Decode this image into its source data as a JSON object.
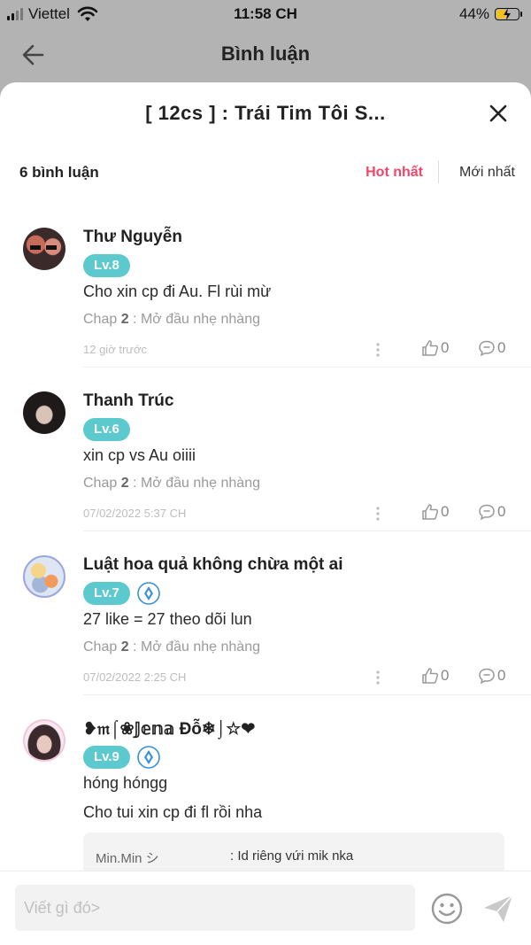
{
  "status": {
    "carrier": "Viettel",
    "time": "11:58 CH",
    "battery": "44%"
  },
  "nav": {
    "title": "Bình luận"
  },
  "sheet": {
    "title": "[ 12cs ] : Trái Tim Tôi S...",
    "count": "6 bình luận",
    "sort_hot": "Hot nhất",
    "sort_new": "Mới nhất"
  },
  "comments": [
    {
      "name": "Thư Nguyễn",
      "level": "Lv.8",
      "text": "Cho xin cp đi Au. Fl rùi mừ",
      "chap_prefix": "Chap ",
      "chap_no": "2",
      "chap_title": " : Mở đầu nhẹ nhàng",
      "time": "12 giờ trước",
      "likes": "0",
      "replies": "0"
    },
    {
      "name": "Thanh Trúc",
      "level": "Lv.6",
      "text": "xin cp vs Au oiiii",
      "chap_prefix": "Chap ",
      "chap_no": "2",
      "chap_title": " : Mở đầu nhẹ nhàng",
      "time": "07/02/2022 5:37 CH",
      "likes": "0",
      "replies": "0"
    },
    {
      "name": "Luật hoa quả không chừa một ai",
      "level": "Lv.7",
      "text": "27 like = 27 theo dõi lun",
      "chap_prefix": "Chap ",
      "chap_no": "2",
      "chap_title": " : Mở đầu nhẹ nhàng",
      "time": "07/02/2022 2:25 CH",
      "likes": "0",
      "replies": "0"
    },
    {
      "name": "❥𝔪⌠❀𝕁𝕖𝕟𝕒 Đỗ❄⌡☆❤",
      "level": "Lv.9",
      "text": "hóng hóngg",
      "text2": "Cho tui xin cp đi fl rồi nha",
      "reply_user": "Min.Min シ",
      "reply_text": ": Id riêng vứi mik nka"
    }
  ],
  "input": {
    "placeholder": "Viết gì đó>"
  },
  "colors": {
    "accent": "#f0466a",
    "level": "#5cc9cf",
    "vip": "#3a8fd9"
  }
}
